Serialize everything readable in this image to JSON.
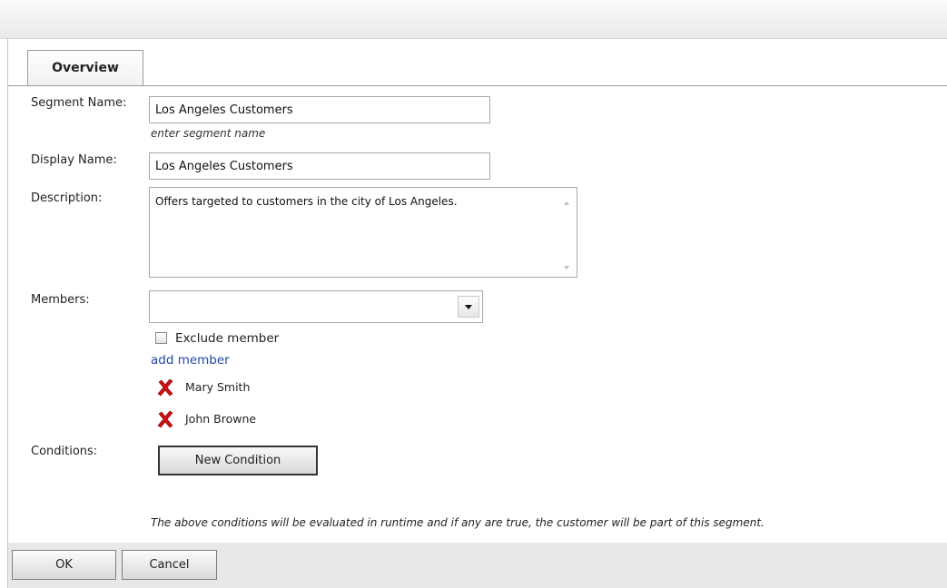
{
  "tabs": [
    {
      "label": "Overview"
    }
  ],
  "form": {
    "segment_name": {
      "label": "Segment Name:",
      "value": "Los Angeles Customers",
      "hint": "enter segment name"
    },
    "display_name": {
      "label": "Display Name:",
      "value": "Los Angeles Customers"
    },
    "description": {
      "label": "Description:",
      "value": "Offers targeted to customers in the city of Los Angeles."
    },
    "members": {
      "label": "Members:",
      "selected": "",
      "exclude_label": "Exclude member",
      "exclude_checked": false,
      "add_link": "add member",
      "list": [
        {
          "name": "Mary Smith"
        },
        {
          "name": "John Browne"
        }
      ]
    },
    "conditions": {
      "label": "Conditions:",
      "button": "New Condition",
      "note": "The above conditions will be evaluated in runtime and if any are true, the customer will be part of this segment."
    }
  },
  "footer": {
    "ok": "OK",
    "cancel": "Cancel"
  },
  "colors": {
    "link": "#2046a8",
    "remove_icon": "#cc1111"
  },
  "icons": {
    "remove": "red-x-icon",
    "dropdown": "triangle-down-icon"
  }
}
